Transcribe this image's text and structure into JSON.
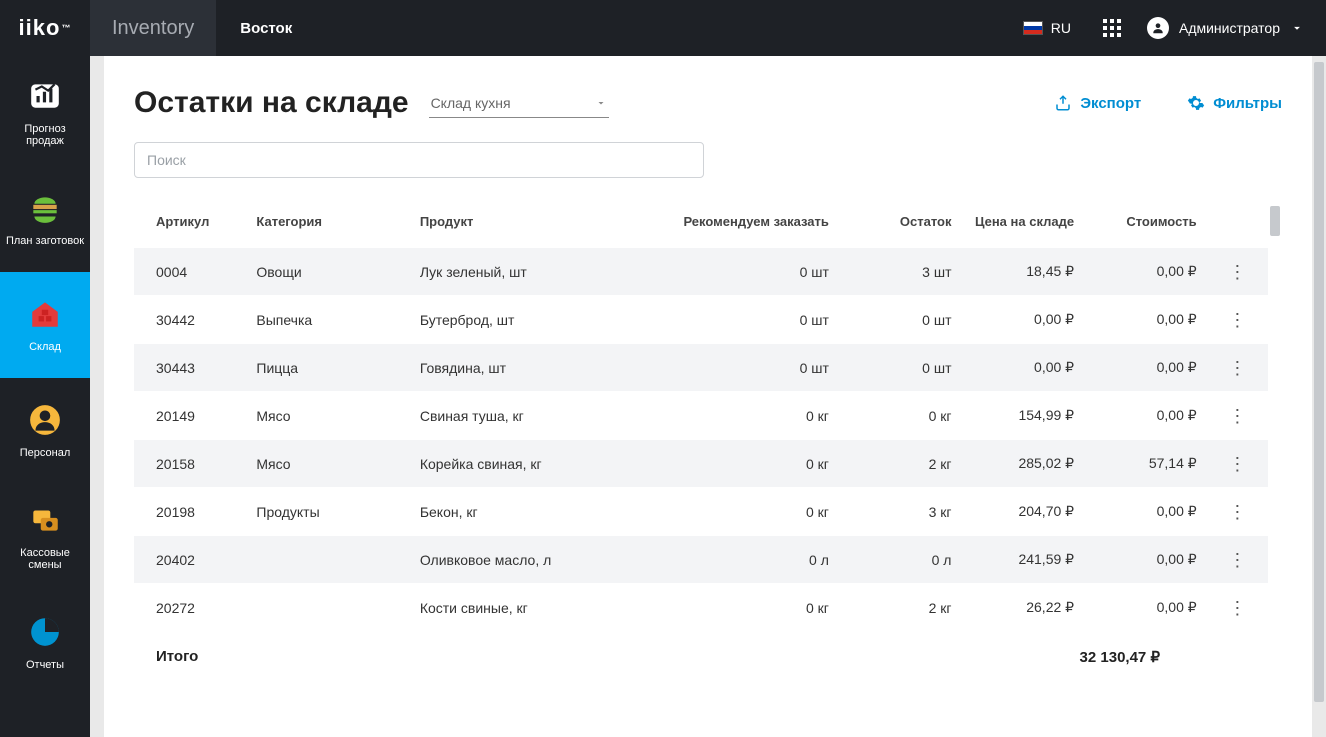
{
  "header": {
    "logo": "iiko",
    "logo_tm": "™",
    "app": "Inventory",
    "location": "Восток",
    "lang_code": "RU",
    "user_name": "Администратор"
  },
  "sidebar": {
    "items": [
      {
        "label": "Прогноз продаж"
      },
      {
        "label": "План заготовок"
      },
      {
        "label": "Склад"
      },
      {
        "label": "Персонал"
      },
      {
        "label": "Кассовые смены"
      },
      {
        "label": "Отчеты"
      }
    ]
  },
  "page": {
    "title": "Остатки на складе",
    "warehouse": "Склад кухня",
    "export_label": "Экспорт",
    "filters_label": "Фильтры",
    "search_placeholder": "Поиск"
  },
  "table": {
    "headers": {
      "sku": "Артикул",
      "category": "Категория",
      "product": "Продукт",
      "recommend": "Рекомендуем заказать",
      "balance": "Остаток",
      "price": "Цена на складе",
      "cost": "Стоимость"
    },
    "rows": [
      {
        "sku": "0004",
        "category": "Овощи",
        "product": "Лук зеленый, шт",
        "recommend": "0 шт",
        "balance": "3 шт",
        "price": "18,45 ₽",
        "cost": "0,00 ₽"
      },
      {
        "sku": "30442",
        "category": "Выпечка",
        "product": "Бутерброд, шт",
        "recommend": "0 шт",
        "balance": "0 шт",
        "price": "0,00 ₽",
        "cost": "0,00 ₽"
      },
      {
        "sku": "30443",
        "category": "Пицца",
        "product": "Говядина, шт",
        "recommend": "0 шт",
        "balance": "0 шт",
        "price": "0,00 ₽",
        "cost": "0,00 ₽"
      },
      {
        "sku": "20149",
        "category": "Мясо",
        "product": "Свиная туша, кг",
        "recommend": "0 кг",
        "balance": "0 кг",
        "price": "154,99 ₽",
        "cost": "0,00 ₽"
      },
      {
        "sku": "20158",
        "category": "Мясо",
        "product": "Корейка свиная, кг",
        "recommend": "0 кг",
        "balance": "2 кг",
        "price": "285,02 ₽",
        "cost": "57,14 ₽"
      },
      {
        "sku": "20198",
        "category": "Продукты",
        "product": "Бекон, кг",
        "recommend": "0 кг",
        "balance": "3 кг",
        "price": "204,70 ₽",
        "cost": "0,00 ₽"
      },
      {
        "sku": "20402",
        "category": "",
        "product": "Оливковое масло, л",
        "recommend": "0 л",
        "balance": "0 л",
        "price": "241,59 ₽",
        "cost": "0,00 ₽"
      },
      {
        "sku": "20272",
        "category": "",
        "product": "Кости свиные, кг",
        "recommend": "0 кг",
        "balance": "2 кг",
        "price": "26,22 ₽",
        "cost": "0,00 ₽"
      }
    ],
    "total_label": "Итого",
    "total_cost": "32 130,47 ₽"
  }
}
